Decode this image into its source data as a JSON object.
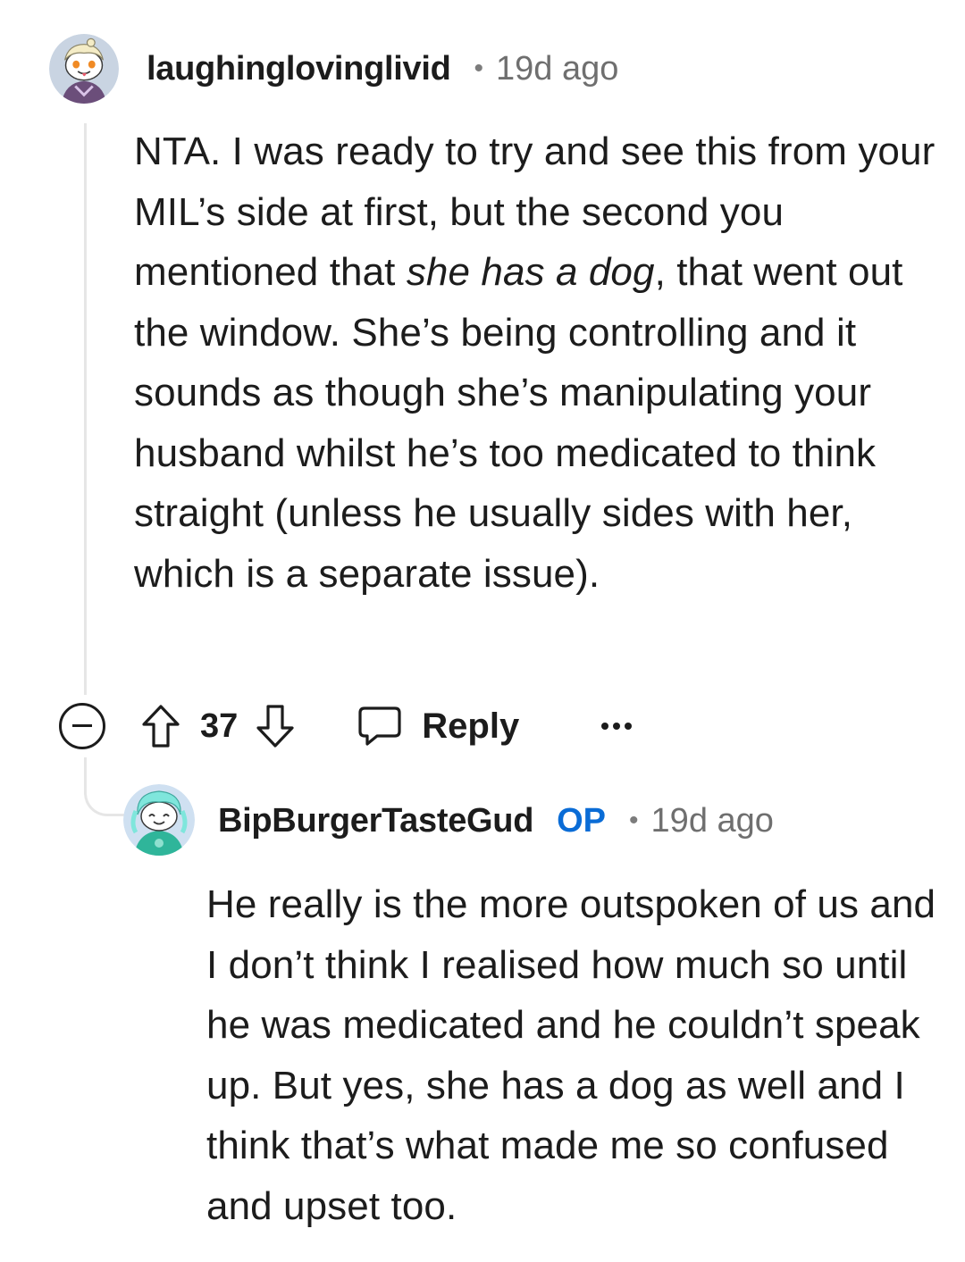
{
  "comment": {
    "author": "laughinglovinglivid",
    "separator": "•",
    "timestamp": "19d ago",
    "body_before_italic": "NTA. I was ready to try and see this from your MIL’s side at first, but the second you mentioned that ",
    "body_italic": "she has a dog",
    "body_after_italic": ", that went out the window. She’s being controlling and it sounds as though she’s manipulating your husband whilst he’s too medicated to think straight (unless he usually sides with her, which is a separate issue).",
    "score": "37",
    "reply_label": "Reply",
    "icons": {
      "avatar": "snoo-avatar-icon",
      "collapse": "collapse-minus-icon",
      "upvote": "upvote-arrow-icon",
      "downvote": "downvote-arrow-icon",
      "reply": "speech-bubble-icon",
      "more": "more-options-icon"
    }
  },
  "reply": {
    "author": "BipBurgerTasteGud",
    "op_badge": "OP",
    "separator": "•",
    "timestamp": "19d ago",
    "body": "He really is the more outspoken of us and I don’t think I realised how much so until he was medicated and he couldn’t speak up. But yes, she has a dog as well and I think that’s what made me so confused and upset too.",
    "icons": {
      "avatar": "snoo-avatar-icon"
    }
  },
  "colors": {
    "text": "#1c1c1c",
    "meta": "#6f6f6f",
    "op_accent": "#0a6cd6",
    "thread_line": "#e6e6e6"
  }
}
